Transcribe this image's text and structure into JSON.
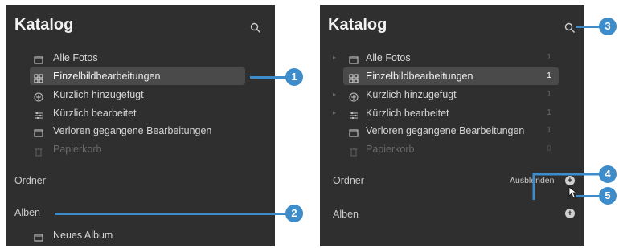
{
  "left_panel": {
    "title": "Katalog",
    "items": [
      {
        "label": "Alle Fotos",
        "icon": "photos-icon"
      },
      {
        "label": "Einzelbildbearbeitungen",
        "icon": "grid-icon"
      },
      {
        "label": "Kürzlich hinzugefügt",
        "icon": "plus-circle-icon"
      },
      {
        "label": "Kürzlich bearbeitet",
        "icon": "sliders-icon"
      },
      {
        "label": "Verloren gegangene Bearbeitungen",
        "icon": "photos-icon"
      },
      {
        "label": "Papierkorb",
        "icon": "trash-icon"
      }
    ],
    "folders_label": "Ordner",
    "albums_label": "Alben",
    "new_album_label": "Neues Album"
  },
  "right_panel": {
    "title": "Katalog",
    "items": [
      {
        "label": "Alle Fotos",
        "count": "1"
      },
      {
        "label": "Einzelbildbearbeitungen",
        "count": "1"
      },
      {
        "label": "Kürzlich hinzugefügt",
        "count": "1"
      },
      {
        "label": "Kürzlich bearbeitet",
        "count": "1"
      },
      {
        "label": "Verloren gegangene Bearbeitungen",
        "count": "1"
      },
      {
        "label": "Papierkorb",
        "count": "0"
      }
    ],
    "folders_label": "Ordner",
    "hide_label": "Ausblenden",
    "albums_label": "Alben"
  },
  "callouts": [
    "1",
    "2",
    "3",
    "4",
    "5"
  ],
  "colors": {
    "panel_bg": "#2f2f2f",
    "selected_bg": "#4a4a4a",
    "callout_blue": "#3e8cc9"
  }
}
